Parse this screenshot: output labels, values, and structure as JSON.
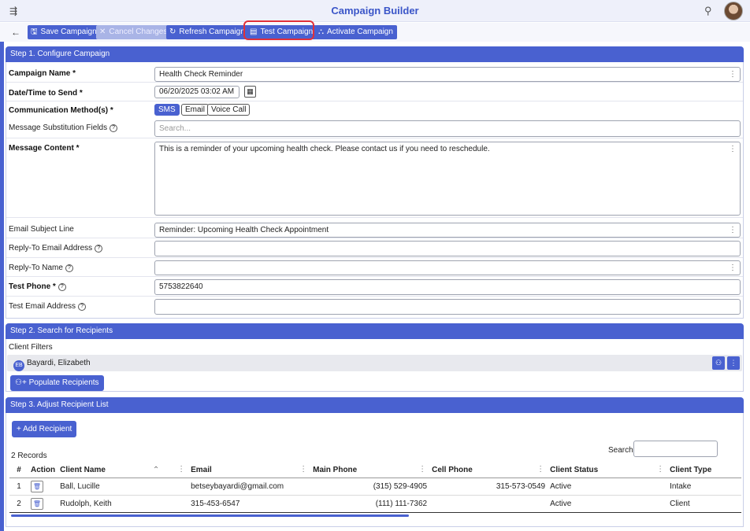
{
  "app": {
    "title": "Campaign Builder"
  },
  "toolbar": {
    "save": "Save Campaign",
    "cancel": "Cancel Changes",
    "refresh": "Refresh Campaign",
    "test": "Test Campaign",
    "activate": "Activate Campaign"
  },
  "step1": {
    "header": "Step 1. Configure Campaign",
    "campaign_name_label": "Campaign Name *",
    "campaign_name_value": "Health Check Reminder",
    "datetime_label": "Date/Time to Send *",
    "datetime_value": "06/20/2025 03:02 AM",
    "comm_label": "Communication Method(s) *",
    "comm_methods": [
      "SMS",
      "Email",
      "Voice Call"
    ],
    "comm_selected": "SMS",
    "subst_label": "Message Substitution Fields",
    "subst_placeholder": "Search...",
    "content_label": "Message Content *",
    "content_value": "This is a reminder of your upcoming health check. Please contact us if you need to reschedule.",
    "subject_label": "Email Subject Line",
    "subject_value": "Reminder: Upcoming Health Check Appointment",
    "reply_email_label": "Reply-To Email Address",
    "reply_email_value": "",
    "reply_name_label": "Reply-To Name",
    "reply_name_value": "",
    "test_phone_label": "Test Phone *",
    "test_phone_value": "5753822640",
    "test_email_label": "Test Email Address",
    "test_email_value": ""
  },
  "step2": {
    "header": "Step 2. Search for Recipients",
    "filters_label": "Client Filters",
    "filter_initials": "EB",
    "filter_name": "Bayardi, Elizabeth",
    "populate": "Populate Recipients"
  },
  "step3": {
    "header": "Step 3. Adjust Recipient List",
    "add": "+ Add Recipient",
    "search_label": "Search:",
    "search_value": "",
    "records": "2 Records",
    "columns": [
      "#",
      "Action",
      "Client Name",
      "Email",
      "Main Phone",
      "Cell Phone",
      "Client Status",
      "Client Type"
    ],
    "rows": [
      {
        "num": "1",
        "name": "Ball, Lucille",
        "email": "betseybayardi@gmail.com",
        "main": "(315) 529-4905",
        "cell": "315-573-0549",
        "status": "Active",
        "type": "Intake"
      },
      {
        "num": "2",
        "name": "Rudolph, Keith",
        "email": "315-453-6547",
        "main": "(111) 111-7362",
        "cell": "",
        "status": "Active",
        "type": "Client"
      }
    ]
  }
}
